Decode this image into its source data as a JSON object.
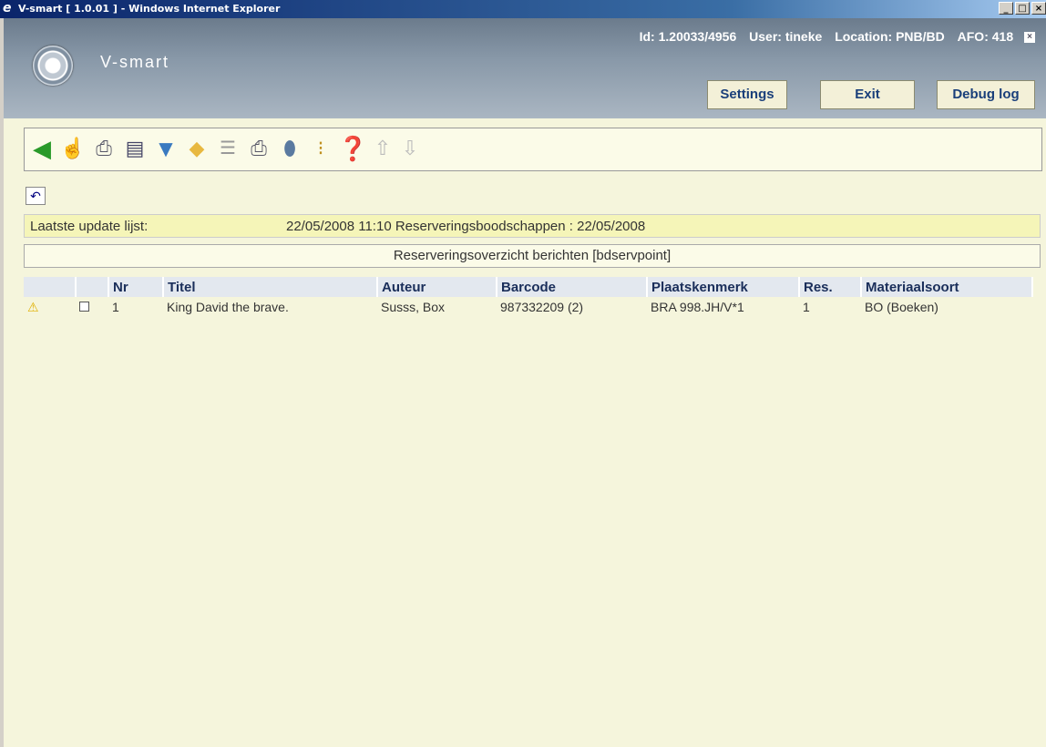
{
  "window": {
    "title": "V-smart [ 1.0.01 ] - Windows Internet Explorer",
    "min": "_",
    "max": "□",
    "close": "×"
  },
  "app": {
    "logo_text": "V-smart",
    "id_label": "Id: 1.20033/4956",
    "user_label": "User: tineke",
    "location_label": "Location: PNB/BD",
    "afo_label": "AFO: 418",
    "close_x": "×",
    "settings_label": "Settings",
    "exit_label": "Exit",
    "debug_label": "Debug log"
  },
  "toolbar": {
    "icons": [
      "back-arrow-icon",
      "select-hand-icon",
      "print-icon",
      "preview-icon",
      "filter-icon",
      "tag-icon",
      "numbered-list-icon",
      "print-multi-icon",
      "trash-icon",
      "traffic-light-icon",
      "help-icon",
      "up-arrow-icon",
      "down-arrow-icon"
    ]
  },
  "undo_icon": "↶",
  "update": {
    "label": "Laatste update lijst:",
    "value": "22/05/2008 11:10 Reserveringsboodschappen : 22/05/2008"
  },
  "caption": "Reserveringsoverzicht berichten [bdservpoint]",
  "table": {
    "headers": [
      "",
      "",
      "Nr",
      "Titel",
      "Auteur",
      "Barcode",
      "Plaatskenmerk",
      "Res.",
      "Materiaalsoort"
    ],
    "rows": [
      {
        "warn": "⚠",
        "nr": "1",
        "titel": "King David the brave.",
        "auteur": "Susss, Box",
        "barcode": "987332209 (2)",
        "plaats": "BRA 998.JH/V*1",
        "res": "1",
        "materiaal": "BO (Boeken)"
      }
    ]
  },
  "colors": {
    "header_bg": "#8898a8",
    "background": "#f5f5dc",
    "update_bar": "#f5f5b8",
    "header_text": "#1a2e5a"
  }
}
